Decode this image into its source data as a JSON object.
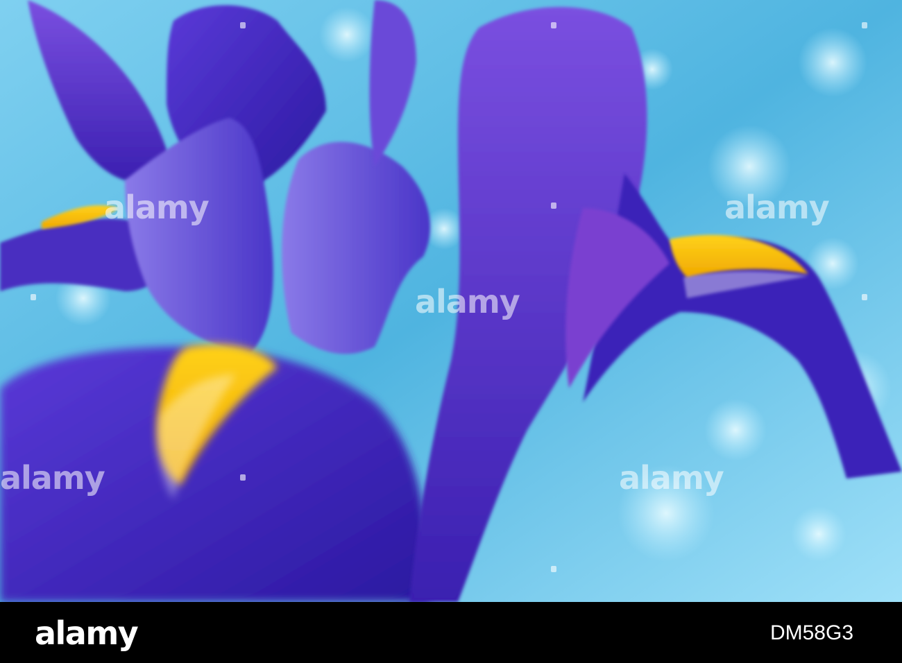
{
  "image": {
    "subject": "blue-iris-flower",
    "colors": {
      "background": "#5ab8e0",
      "petal_dark": "#3a1fa8",
      "petal_mid": "#5a3dd0",
      "petal_light": "#8a6fe8",
      "signal_yellow": "#f5c400"
    }
  },
  "watermark": {
    "text": "alamy"
  },
  "footer": {
    "logo": "alamy",
    "image_id": "DM58G3"
  }
}
